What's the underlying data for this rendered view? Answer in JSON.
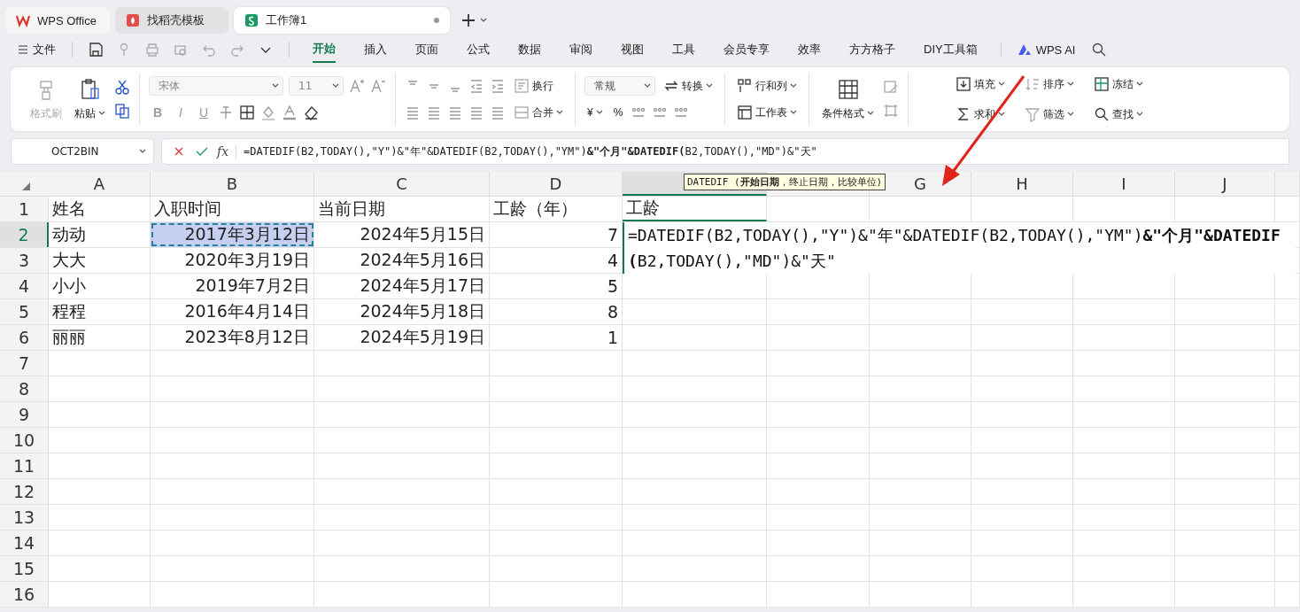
{
  "tabs": [
    {
      "label": "WPS Office",
      "kind": "home",
      "selected": false
    },
    {
      "label": "找稻壳模板",
      "kind": "template",
      "selected": false
    },
    {
      "label": "工作簿1",
      "kind": "sheet",
      "selected": true
    }
  ],
  "menu": {
    "file": "文件",
    "tabs": [
      {
        "label": "开始",
        "selected": true
      },
      {
        "label": "插入",
        "selected": false
      },
      {
        "label": "页面",
        "selected": false
      },
      {
        "label": "公式",
        "selected": false
      },
      {
        "label": "数据",
        "selected": false
      },
      {
        "label": "审阅",
        "selected": false
      },
      {
        "label": "视图",
        "selected": false
      },
      {
        "label": "工具",
        "selected": false
      },
      {
        "label": "会员专享",
        "selected": false
      },
      {
        "label": "效率",
        "selected": false
      },
      {
        "label": "方方格子",
        "selected": false
      },
      {
        "label": "DIY工具箱",
        "selected": false
      }
    ],
    "ai": "WPS AI"
  },
  "ribbon": {
    "format_painter": {
      "label": "格式刷",
      "disabled": true
    },
    "paste": {
      "label": "粘贴",
      "disabled": false
    },
    "font": {
      "name": "宋体",
      "size": "11",
      "style_buttons": [
        "B",
        "I",
        "U"
      ]
    },
    "wrap": {
      "label": "换行",
      "disabled": true
    },
    "merge": {
      "label": "合并",
      "disabled": true
    },
    "number_format": "常规",
    "convert": "转换",
    "currency": "¥",
    "percent": "%",
    "cells": [
      {
        "label": "行和列",
        "disabled": false
      },
      {
        "label": "工作表",
        "disabled": false
      }
    ],
    "conditional_format": "条件格式",
    "editing": [
      {
        "label": "填充",
        "disabled": false
      },
      {
        "label": "排序",
        "disabled": true
      },
      {
        "label": "冻结",
        "disabled": false
      },
      {
        "label": "求和",
        "disabled": false
      },
      {
        "label": "筛选",
        "disabled": true
      },
      {
        "label": "查找",
        "disabled": false
      }
    ]
  },
  "formula_bar": {
    "name_box": "OCT2BIN",
    "fx": "fx",
    "formula": "=DATEDIF(B2,TODAY(),\"Y\")&\"年\"&DATEDIF(B2,TODAY(),\"YM\")**&\"个月\"&DATEDIF(**B2,TODAY(),\"MD\")&\"天\""
  },
  "tooltip": "DATEDIF (**开始日期**，终止日期，比较单位)",
  "columns": [
    {
      "label": "A",
      "selected": false
    },
    {
      "label": "B",
      "selected": false
    },
    {
      "label": "C",
      "selected": false
    },
    {
      "label": "D",
      "selected": false
    },
    {
      "selected": true
    },
    {
      "selected": false
    },
    {
      "label": "G",
      "selected": false
    },
    {
      "label": "H",
      "selected": false
    },
    {
      "label": "I",
      "selected": false
    },
    {
      "label": "J",
      "selected": false
    }
  ],
  "rows": [
    {
      "number": "1",
      "selected": false,
      "cells": [
        {
          "text": "姓名",
          "referenced": false
        },
        {
          "text": "入职时间",
          "referenced": false
        },
        {
          "text": "当前日期",
          "referenced": false
        },
        {
          "text": "工龄（年）",
          "referenced": false
        },
        {
          "text": "工龄",
          "referenced": false
        }
      ]
    },
    {
      "number": "2",
      "selected": true,
      "cells": [
        {
          "text": "动动",
          "referenced": false
        },
        {
          "text": "2017年3月12日",
          "referenced": true
        },
        {
          "text": "2024年5月15日",
          "referenced": false
        },
        {
          "text": "7",
          "referenced": false
        },
        {
          "formula": "=DATEDIF(B2,TODAY(),\"Y\")&\"年\"&DATEDIF(B2,TODAY(),\"YM\")**&\"个月\"&DATEDIF(**B2,TODAY(),\"MD\")&\"天\""
        }
      ]
    },
    {
      "number": "3",
      "selected": false,
      "cells": [
        {
          "text": "大大",
          "referenced": false
        },
        {
          "text": "2020年3月19日",
          "referenced": false
        },
        {
          "text": "2024年5月16日",
          "referenced": false
        },
        {
          "text": "4",
          "referenced": false
        }
      ]
    },
    {
      "number": "4",
      "selected": false,
      "cells": [
        {
          "text": "小小",
          "referenced": false
        },
        {
          "text": "2019年7月2日",
          "referenced": false
        },
        {
          "text": "2024年5月17日",
          "referenced": false
        },
        {
          "text": "5",
          "referenced": false
        }
      ]
    },
    {
      "number": "5",
      "selected": false,
      "cells": [
        {
          "text": "程程",
          "referenced": false
        },
        {
          "text": "2016年4月14日",
          "referenced": false
        },
        {
          "text": "2024年5月18日",
          "referenced": false
        },
        {
          "text": "8",
          "referenced": false
        }
      ]
    },
    {
      "number": "6",
      "selected": false,
      "cells": [
        {
          "text": "丽丽",
          "referenced": false
        },
        {
          "text": "2023年8月12日",
          "referenced": false
        },
        {
          "text": "2024年5月19日",
          "referenced": false
        },
        {
          "text": "1",
          "referenced": false
        }
      ]
    },
    {
      "number": "7",
      "selected": false
    },
    {
      "number": "8",
      "selected": false
    },
    {
      "number": "9",
      "selected": false
    },
    {
      "number": "10",
      "selected": false
    },
    {
      "number": "11",
      "selected": false
    },
    {
      "number": "12",
      "selected": false
    },
    {
      "number": "13",
      "selected": false
    },
    {
      "number": "14",
      "selected": false
    },
    {
      "number": "15",
      "selected": false
    },
    {
      "number": "16",
      "selected": false
    }
  ]
}
